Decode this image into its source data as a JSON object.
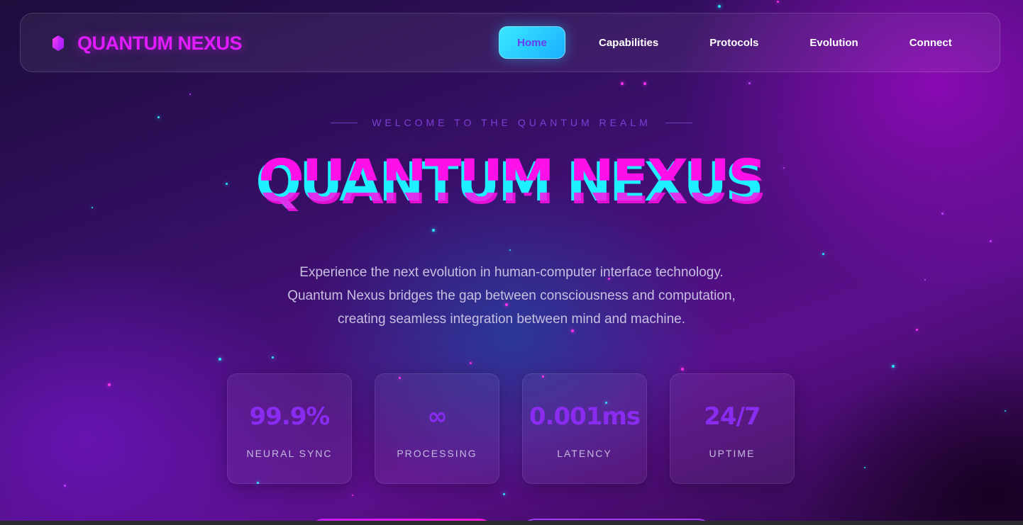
{
  "nav": {
    "logo_text": "QUANTUM NEXUS",
    "logo_icon": "hexagon-gem-icon",
    "links": [
      {
        "label": "Home",
        "active": true
      },
      {
        "label": "Capabilities",
        "active": false
      },
      {
        "label": "Protocols",
        "active": false
      },
      {
        "label": "Evolution",
        "active": false
      },
      {
        "label": "Connect",
        "active": false
      }
    ]
  },
  "hero": {
    "eyebrow": "WELCOME TO THE QUANTUM REALM",
    "title": "QUANTUM NEXUS",
    "description": [
      "Experience the next evolution in human-computer interface technology.",
      "Quantum Nexus bridges the gap between consciousness and computation,",
      "creating seamless integration between mind and machine."
    ]
  },
  "stats": [
    {
      "value": "99.9%",
      "label": "NEURAL SYNC"
    },
    {
      "value": "∞",
      "label": "PROCESSING"
    },
    {
      "value": "0.001ms",
      "label": "LATENCY"
    },
    {
      "value": "24/7",
      "label": "UPTIME"
    }
  ],
  "colors": {
    "accent_magenta": "#e21cff",
    "accent_cyan": "#1ff0ff",
    "stat_value": "#8a2bf0"
  }
}
